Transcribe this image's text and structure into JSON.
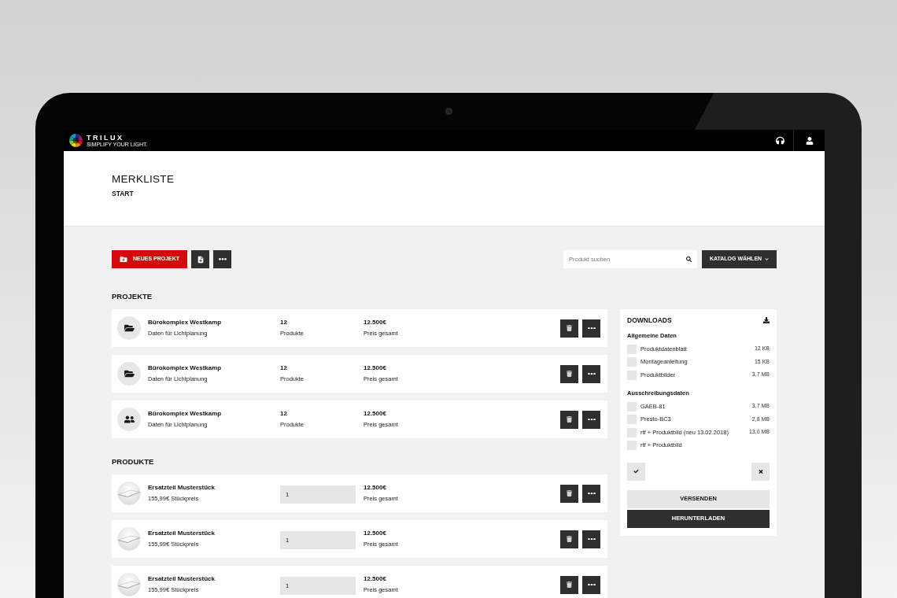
{
  "header": {
    "logo_name": "TRILUX",
    "logo_tagline": "SIMPLIFY YOUR LIGHT."
  },
  "page_header": {
    "title": "MERKLISTE",
    "breadcrumb": "START"
  },
  "toolbar": {
    "new_project_button": "NEUES PROJEKT",
    "search": {
      "placeholder": "Produkt suchen"
    },
    "catalog_button": "KATALOG WÄHLEN"
  },
  "projects": {
    "heading": "PROJEKTE",
    "items": [
      {
        "kind": "folder",
        "name": "Bürokomplex Westkamp",
        "subtitle": "Daten für Lichtplanung",
        "count": "12",
        "count_label": "Produkte",
        "price": "12.500€",
        "price_label": "Preis gesamt"
      },
      {
        "kind": "folder",
        "name": "Bürokomplex Westkamp",
        "subtitle": "Daten für Lichtplanung",
        "count": "12",
        "count_label": "Produkte",
        "price": "12.500€",
        "price_label": "Preis gesamt"
      },
      {
        "kind": "group",
        "name": "Bürokomplex Westkamp",
        "subtitle": "Daten für Lichtplanung",
        "count": "12",
        "count_label": "Produkte",
        "price": "12.500€",
        "price_label": "Preis gesamt"
      }
    ]
  },
  "products": {
    "heading": "PRODUKTE",
    "items": [
      {
        "name": "Ersatzteil Musterstück",
        "unit_price": "155,99€ Stückpreis",
        "quantity": "1",
        "price": "12.500€",
        "price_label": "Preis gesamt"
      },
      {
        "name": "Ersatzteil Musterstück",
        "unit_price": "155,99€ Stückpreis",
        "quantity": "1",
        "price": "12.500€",
        "price_label": "Preis gesamt"
      },
      {
        "name": "Ersatzteil Musterstück",
        "unit_price": "155,99€ Stückpreis",
        "quantity": "1",
        "price": "12.500€",
        "price_label": "Preis gesamt"
      }
    ]
  },
  "downloads": {
    "title": "DOWNLOADS",
    "groups": [
      {
        "title": "Allgemeine Daten",
        "files": [
          {
            "name": "Produktdatenblatt",
            "size": "12 KB",
            "checked": false
          },
          {
            "name": "Montageanleitung",
            "size": "15 KB",
            "checked": false
          },
          {
            "name": "Produktbilder",
            "size": "3,7 MB",
            "checked": false
          }
        ]
      },
      {
        "title": "Ausschreibungsdaten",
        "files": [
          {
            "name": "GAEB-81",
            "size": "3,7 MB",
            "checked": false
          },
          {
            "name": "Presto-BC3",
            "size": "2,8 MB",
            "checked": false
          },
          {
            "name": "rtf + Produktbild (neu 13.02.2018)",
            "size": "13,0 MB",
            "checked": false
          },
          {
            "name": "rtf + Produktbild",
            "checked": false
          }
        ]
      }
    ],
    "buttons": [
      {
        "label": "VERSENDEN",
        "kind": "secondary"
      },
      {
        "label": "HERUNTERLADEN",
        "kind": "primary"
      }
    ]
  }
}
